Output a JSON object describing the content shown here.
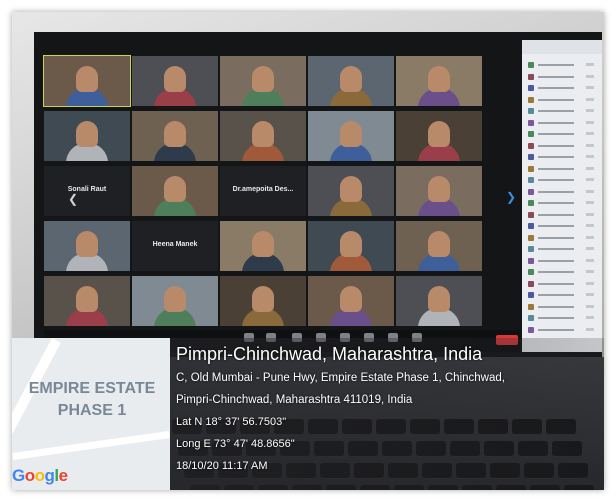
{
  "geotag": {
    "title": "Pimpri-Chinchwad, Maharashtra, India",
    "address_line1": "C, Old Mumbai - Pune Hwy, Empire Estate Phase 1, Chinchwad,",
    "address_line2": "Pimpri-Chinchwad, Maharashtra 411019, India",
    "latitude": "Lat N 18° 37' 56.7503\"",
    "longitude": "Long E 73° 47' 48.8656\"",
    "datetime": "18/10/20 11:17 AM"
  },
  "map": {
    "label_line1": "EMPIRE ESTATE",
    "label_line2": "PHASE 1",
    "logo_text": "Google"
  },
  "meeting": {
    "text_tiles": [
      "Sonali Raut",
      "Dr.amepoita Des...",
      "Heena Manek"
    ],
    "navigation": {
      "prev_icon": "chevron-left-icon",
      "next_icon": "chevron-right-icon"
    }
  },
  "colors": {
    "active_speaker": "#c9d64a",
    "end_button": "#d8383a",
    "nav_accent": "#3a8de0"
  }
}
